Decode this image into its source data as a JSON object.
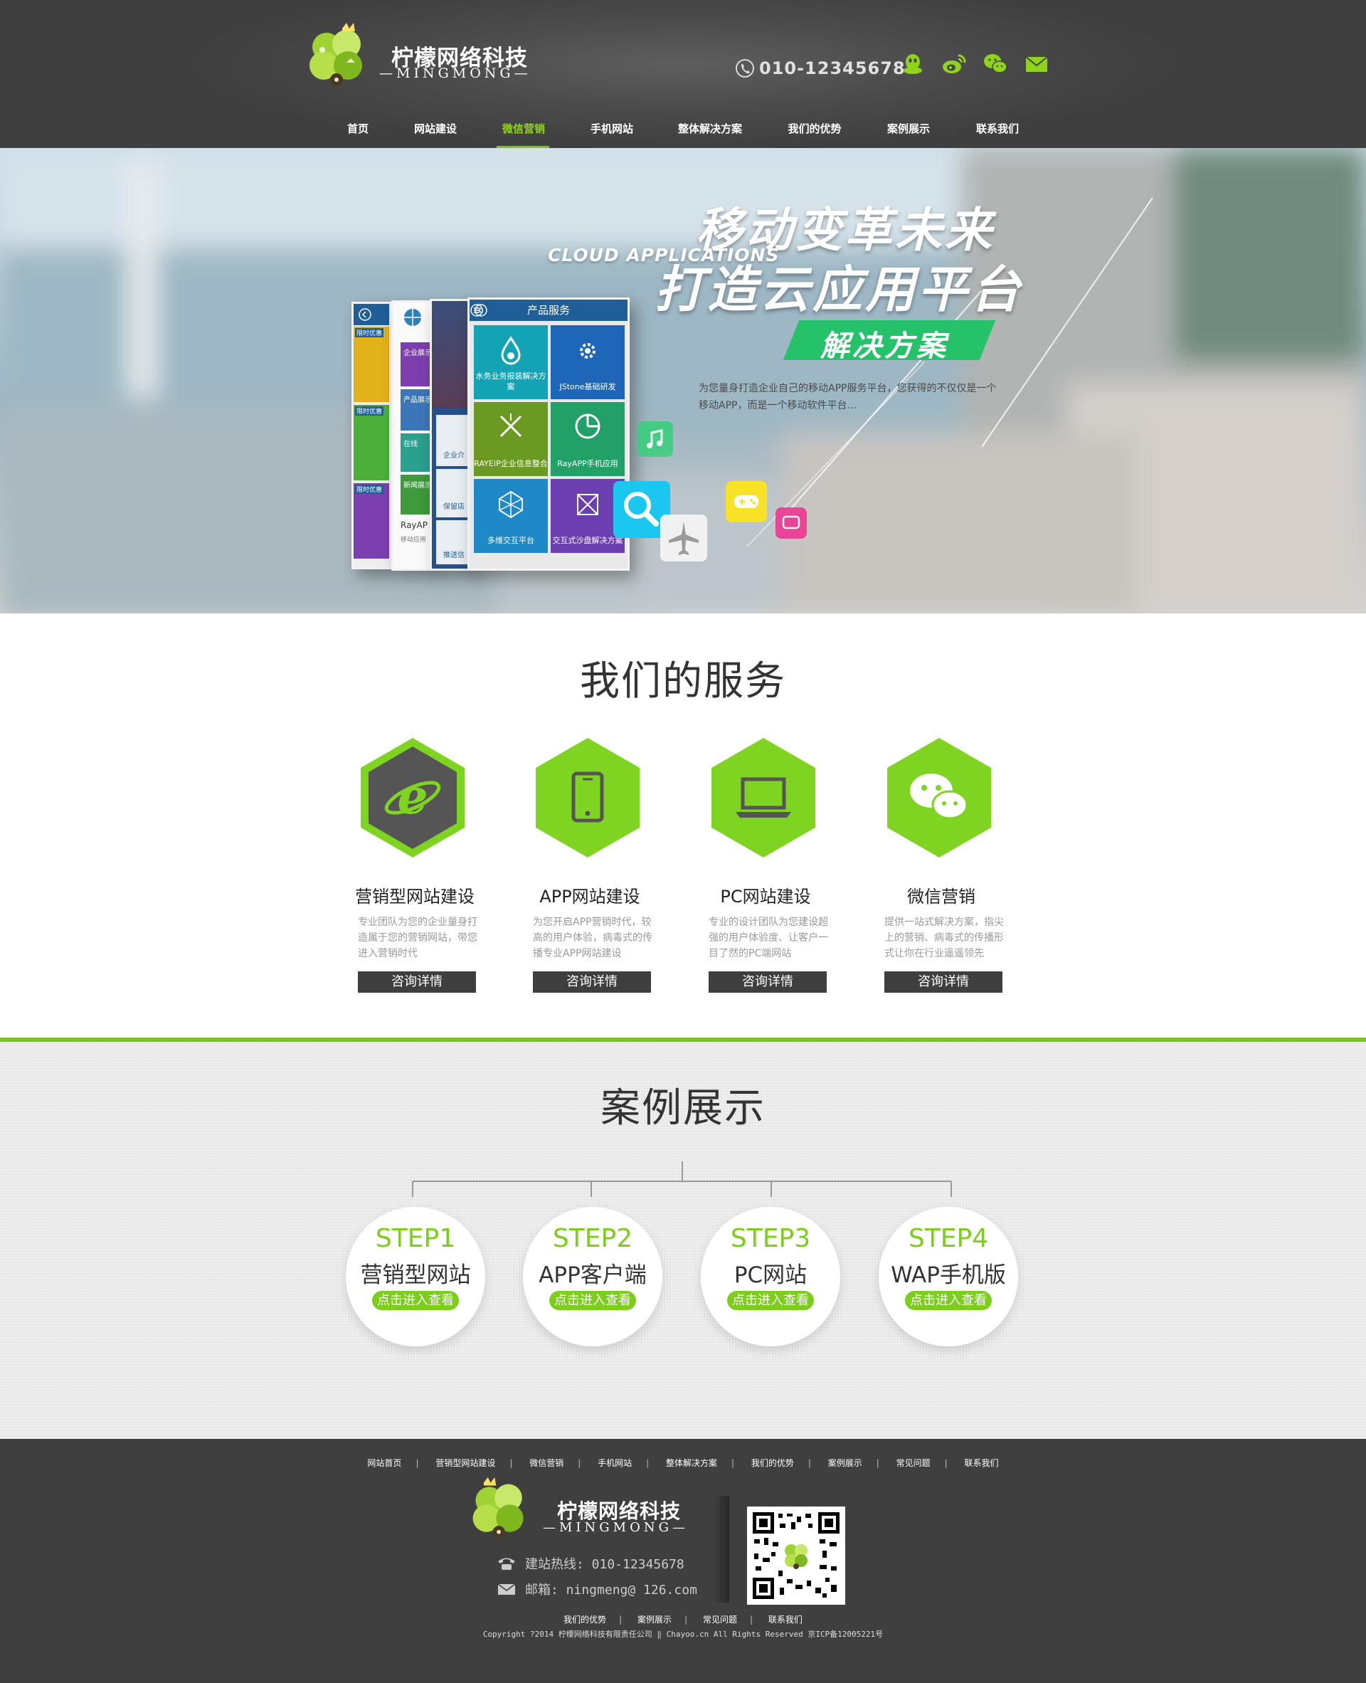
{
  "header": {
    "brand_cn": "柠檬网络科技",
    "brand_en": "—MINGMONG—",
    "phone": "010-12345678",
    "social_icons": [
      "qq-icon",
      "weibo-icon",
      "wechat-icon",
      "mail-icon"
    ],
    "accent": "#7cc518"
  },
  "nav": {
    "items": [
      "首页",
      "网站建设",
      "微信营销",
      "手机网站",
      "整体解决方案",
      "我们的优势",
      "案例展示",
      "联系我们"
    ],
    "active_index": 2
  },
  "banner": {
    "title1": "移动变革未来",
    "subtitle_en": "CLOUD APPLICATIONS",
    "title2": "打造云应用平台",
    "tag": "解决方案",
    "description": "为您量身打造企业自己的移动APP服务平台，您获得的不仅仅是一个移动APP，而是一个移动软件平台...",
    "card_header": "产品服务",
    "tiles": [
      "水务业务报装解决方案",
      "JStone基础研发",
      "RAYEIP企业信息整合",
      "RayAPP手机应用",
      "多维交互平台",
      "交互式沙盘解决方案"
    ],
    "back_card_labels": [
      "限时优惠",
      "限时优惠",
      "限时优惠",
      "企业展示",
      "产品展示",
      "在线",
      "新闻展示",
      "RayAP",
      "移动应用",
      "企业介",
      "保留店",
      "推送信"
    ]
  },
  "services": {
    "title": "我们的服务",
    "items": [
      {
        "title": "营销型网站建设",
        "desc": "专业团队为您的企业量身打造属于您的营销网站，带您进入营销时代",
        "button": "咨询详情",
        "icon": "ie-icon"
      },
      {
        "title": "APP网站建设",
        "desc": "为您开启APP营销时代，较高的用户体验，病毒式的传播专业APP网站建设",
        "button": "咨询详情",
        "icon": "mobile-icon"
      },
      {
        "title": "PC网站建设",
        "desc": "专业的设计团队为您建设超强的用户体验度、让客户一目了然的PC端网站",
        "button": "咨询详情",
        "icon": "laptop-icon"
      },
      {
        "title": "微信营销",
        "desc": "提供一站式解决方案，指尖上的营销、病毒式的传播形式让你在行业遥遥领先",
        "button": "咨询详情",
        "icon": "wechat-icon"
      }
    ]
  },
  "cases": {
    "title": "案例展示",
    "steps": [
      {
        "step": "STEP1",
        "name": "营销型网站",
        "button": "点击进入查看"
      },
      {
        "step": "STEP2",
        "name": "APP客户端",
        "button": "点击进入查看"
      },
      {
        "step": "STEP3",
        "name": "PC网站",
        "button": "点击进入查看"
      },
      {
        "step": "STEP4",
        "name": "WAP手机版",
        "button": "点击进入查看"
      }
    ]
  },
  "footer": {
    "links": [
      "网站首页",
      "营销型网站建设",
      "微信营销",
      "手机网站",
      "整体解决方案",
      "我们的优势",
      "案例展示",
      "常见问题",
      "联系我们"
    ],
    "brand_cn": "柠檬网络科技",
    "brand_en": "—MINGMONG—",
    "hotline": "建站热线: 010-12345678",
    "email": "邮箱: ningmeng@ 126.com",
    "links2": [
      "我们的优势",
      "案例展示",
      "常见问题",
      "联系我们"
    ],
    "copyright": "Copyright ?2014  柠檬网络科技有限责任公司  ‖  Chayoo.cn All Rights Reserved  京ICP备12005221号"
  }
}
